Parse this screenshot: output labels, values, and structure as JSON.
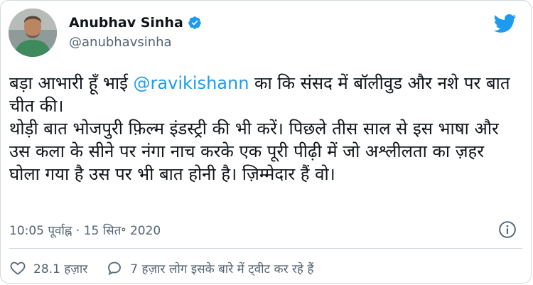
{
  "author": {
    "name": "Anubhav Sinha",
    "handle": "@anubhavsinha"
  },
  "tweet": {
    "line1_before": "बड़ा आभारी हूँ भाई ",
    "mention": "@ravikishann",
    "line1_after": " का कि संसद में बॉलीवुड और नशे पर बात चीत की।",
    "line2": "थोड़ी बात भोजपुरी फ़िल्म इंडस्ट्री की भी करें। पिछले तीस साल से इस भाषा और उस कला के सीने पर नंगा नाच करके एक पूरी पीढ़ी में जो अश्लीलता का ज़हर घोला गया है उस पर भी बात होनी है। ज़िम्मेदार हैं वो।"
  },
  "timestamp": "10:05 पूर्वाह्न · 15 सित॰ 2020",
  "actions": {
    "likes": "28.1 हज़ार",
    "discussion": "7 हज़ार लोग इसके बारे में ट्वीट कर रहे हैं"
  },
  "colors": {
    "brand_blue": "#1d9bf0",
    "text": "#0f1419",
    "secondary": "#536471"
  },
  "icons": {
    "bird": "twitter-bird-icon",
    "verified": "verified-badge-icon",
    "info": "info-icon",
    "like": "heart-icon",
    "reply": "speech-bubble-icon"
  }
}
